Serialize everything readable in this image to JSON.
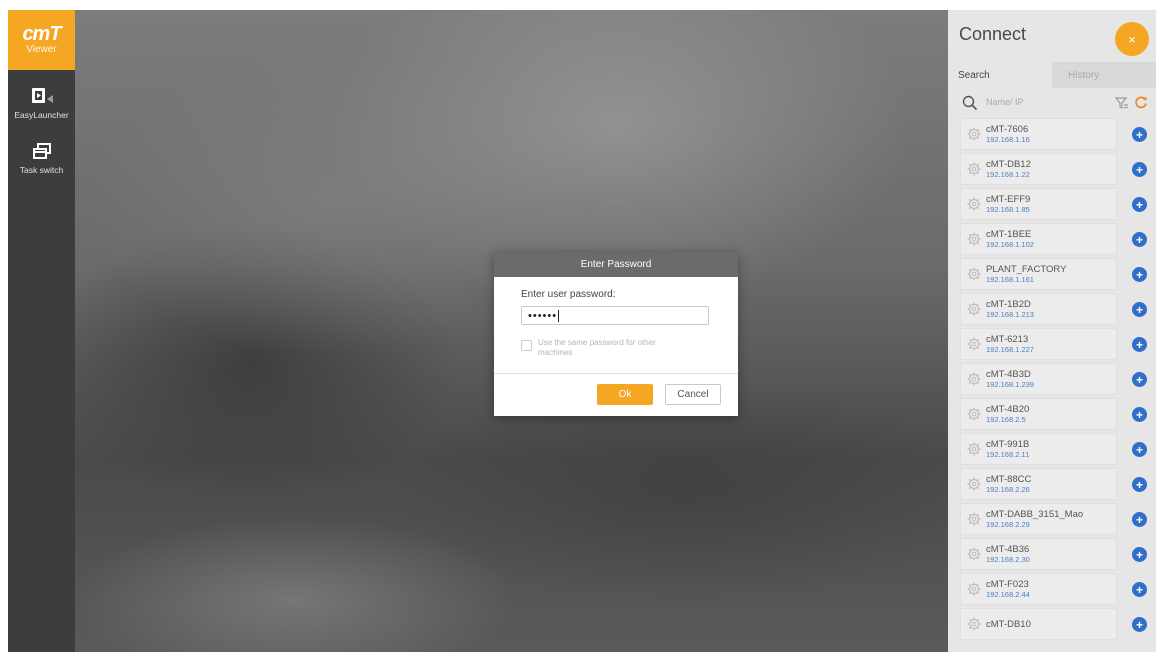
{
  "sidebar": {
    "logo_main": "cmT",
    "logo_sub": "Viewer",
    "items": [
      {
        "label": "EasyLauncher",
        "icon": "easylauncher-icon"
      },
      {
        "label": "Task switch",
        "icon": "task-switch-icon"
      }
    ]
  },
  "dialog": {
    "title": "Enter Password",
    "prompt": "Enter user password:",
    "password_mask": "••••••",
    "checkbox_label": "Use the same password for other machines",
    "ok_label": "Ok",
    "cancel_label": "Cancel"
  },
  "panel": {
    "title": "Connect",
    "close_icon": "×",
    "tabs": [
      "Search",
      "History"
    ],
    "search_placeholder": "Name/ IP",
    "devices": [
      {
        "name": "cMT-7606",
        "ip": "192.168.1.16"
      },
      {
        "name": "cMT-DB12",
        "ip": "192.168.1.22"
      },
      {
        "name": "cMT-EFF9",
        "ip": "192.168.1.85"
      },
      {
        "name": "cMT-1BEE",
        "ip": "192.168.1.102"
      },
      {
        "name": "PLANT_FACTORY",
        "ip": "192.168.1.161"
      },
      {
        "name": "cMT-1B2D",
        "ip": "192.168.1.213"
      },
      {
        "name": "cMT-6213",
        "ip": "192.168.1.227"
      },
      {
        "name": "cMT-4B3D",
        "ip": "192.168.1.239"
      },
      {
        "name": "cMT-4B20",
        "ip": "192.168.2.5"
      },
      {
        "name": "cMT-991B",
        "ip": "192.168.2.11"
      },
      {
        "name": "cMT-88CC",
        "ip": "192.168.2.26"
      },
      {
        "name": "cMT-DABB_3151_Mao",
        "ip": "192.168.2.29"
      },
      {
        "name": "cMT-4B36",
        "ip": "192.168.2.30"
      },
      {
        "name": "cMT-F023",
        "ip": "192.168.2.44"
      },
      {
        "name": "cMT-DB10",
        "ip": ""
      }
    ]
  },
  "colors": {
    "accent": "#f5a623",
    "sidebar_bg": "#3b3d3f",
    "add_button": "#2f6fc9",
    "ip_text": "#4a7fc1"
  }
}
